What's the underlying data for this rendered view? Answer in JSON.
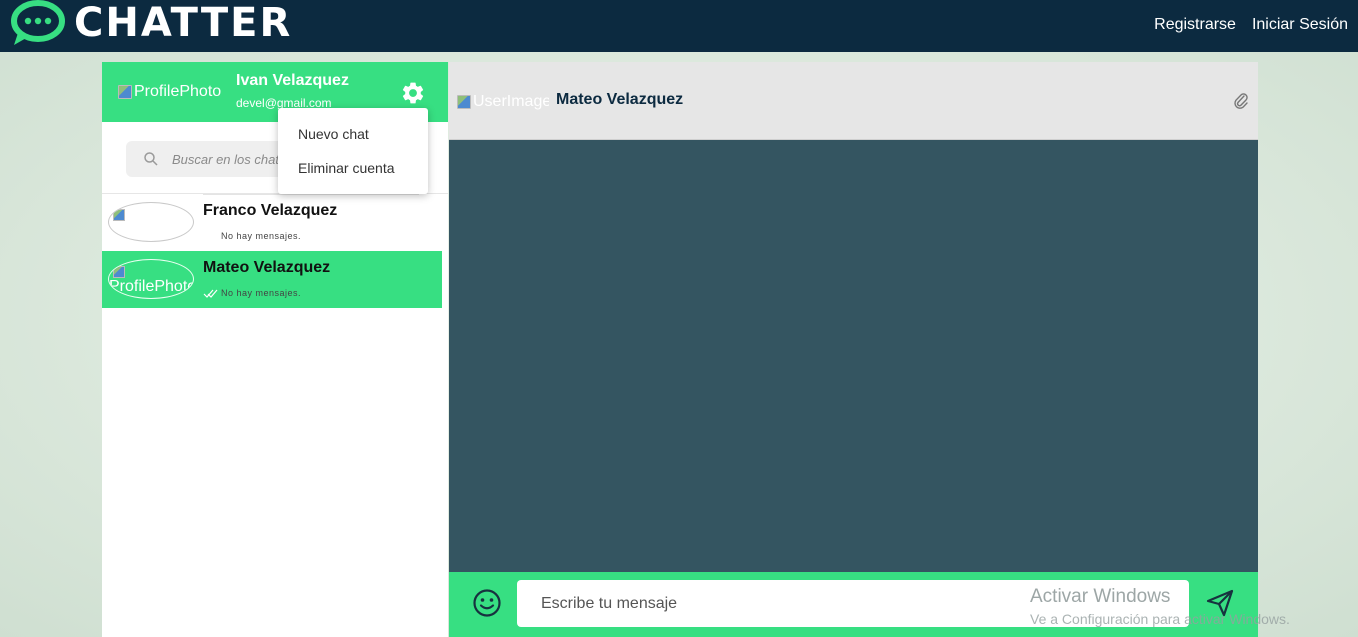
{
  "header": {
    "logo_text": "CHATTER",
    "nav": {
      "register": "Registrarse",
      "login": "Iniciar Sesión"
    }
  },
  "profile": {
    "photo_alt": "ProfilePhoto",
    "name": "Ivan Velazquez",
    "email": "devel@gmail.com"
  },
  "menu": {
    "items": [
      "Nuevo chat",
      "Eliminar cuenta"
    ]
  },
  "search": {
    "placeholder": "Buscar en los chats"
  },
  "contacts": [
    {
      "name": "Franco Velazquez",
      "avatar_alt": "",
      "last_message": "No hay mensajes.",
      "active": false,
      "read_ticks": false
    },
    {
      "name": "Mateo Velazquez",
      "avatar_alt": "ProfilePhoto",
      "last_message": "No hay mensajes.",
      "active": true,
      "read_ticks": true
    }
  ],
  "chat": {
    "user_image_alt": "UserImage",
    "contact_name": "Mateo Velazquez"
  },
  "composer": {
    "placeholder": "Escribe tu mensaje"
  },
  "watermark": {
    "title": "Activar Windows",
    "subtitle": "Ve a Configuración para activar Windows."
  },
  "colors": {
    "topbar": "#0c2a40",
    "accent": "#37df82",
    "chat_background": "#345561"
  },
  "icons": [
    "chat-bubbles-logo-icon",
    "gear-icon",
    "search-icon",
    "double-check-icon",
    "paperclip-icon",
    "smiley-icon",
    "send-icon"
  ]
}
